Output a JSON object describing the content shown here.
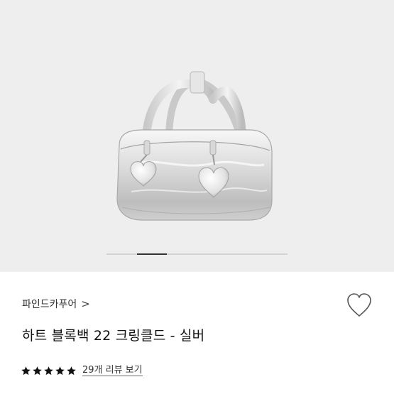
{
  "gallery": {
    "image_description_icon": "silver-handbag-image",
    "slides_total": 6,
    "active_slide_index": 1
  },
  "product": {
    "brand": "파인드카푸어",
    "brand_chevron": ">",
    "title": "하트 블록백 22 크링클드 - 실버",
    "rating": 5,
    "rating_max": 5,
    "review_link": "29개 리뷰 보기"
  },
  "colors": {
    "gallery_bg": "#eeeeee",
    "star": "#111111",
    "text": "#111111"
  }
}
